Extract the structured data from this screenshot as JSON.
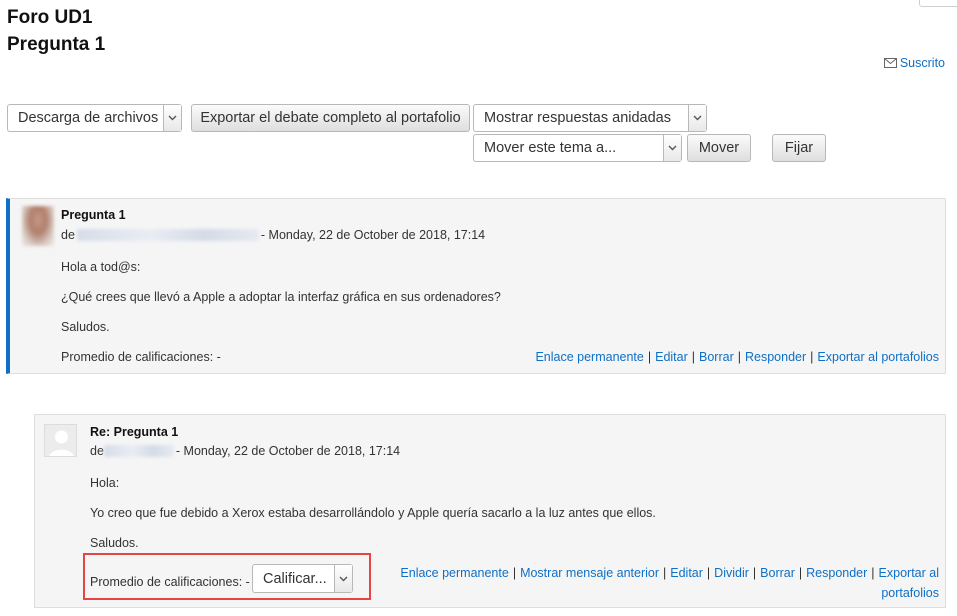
{
  "forum_title": "Foro UD1",
  "discussion_title": "Pregunta 1",
  "subscription": {
    "label": "Suscrito",
    "icon": "envelope-icon"
  },
  "toolbar": {
    "download_select": "Descarga de archivos",
    "export_button": "Exportar el debate completo al portafolio",
    "display_select": "Mostrar respuestas anidadas",
    "move_select": "Mover este tema a...",
    "move_button": "Mover",
    "pin_button": "Fijar"
  },
  "posts": [
    {
      "subject": "Pregunta 1",
      "by_prefix": "de",
      "date": "- Monday, 22 de October de 2018, 17:14",
      "lines": [
        "Hola a tod@s:",
        "¿Qué crees que llevó a Apple a adoptar la interfaz gráfica en sus ordenadores?",
        "Saludos."
      ],
      "rating_label": "Promedio de calificaciones: -",
      "links": [
        "Enlace permanente",
        "Editar",
        "Borrar",
        "Responder",
        "Exportar al portafolios"
      ]
    },
    {
      "subject": "Re: Pregunta 1",
      "by_prefix": "de",
      "date": "- Monday, 22 de October de 2018, 17:14",
      "lines": [
        "Hola:",
        "Yo creo que fue debido a Xerox estaba desarrollándolo y Apple quería sacarlo a la luz antes que ellos.",
        "Saludos."
      ],
      "rating_label": "Promedio de calificaciones: -",
      "rating_select": "Calificar...",
      "links_line1": [
        "Enlace permanente",
        "Mostrar mensaje anterior",
        "Editar",
        "Dividir",
        "Borrar",
        "Responder",
        "Exportar al"
      ],
      "links_line2": "portafolios"
    }
  ],
  "colors": {
    "link": "#0f6fc5",
    "accent_border": "#0f6fc5",
    "highlight": "#e64545",
    "post_bg": "#f5f5f5"
  }
}
